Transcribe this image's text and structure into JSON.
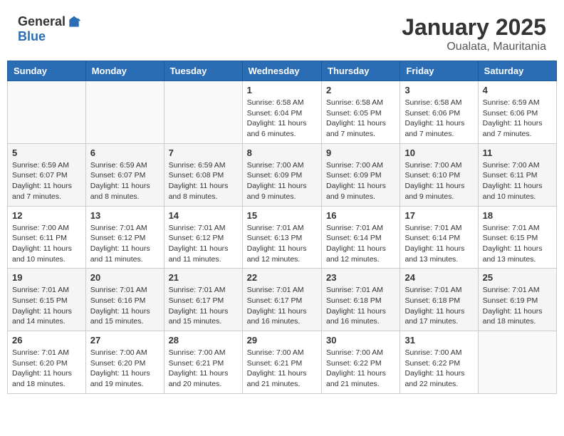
{
  "header": {
    "logo_general": "General",
    "logo_blue": "Blue",
    "month": "January 2025",
    "location": "Oualata, Mauritania"
  },
  "days_of_week": [
    "Sunday",
    "Monday",
    "Tuesday",
    "Wednesday",
    "Thursday",
    "Friday",
    "Saturday"
  ],
  "weeks": [
    [
      {
        "day": "",
        "info": ""
      },
      {
        "day": "",
        "info": ""
      },
      {
        "day": "",
        "info": ""
      },
      {
        "day": "1",
        "info": "Sunrise: 6:58 AM\nSunset: 6:04 PM\nDaylight: 11 hours and 6 minutes."
      },
      {
        "day": "2",
        "info": "Sunrise: 6:58 AM\nSunset: 6:05 PM\nDaylight: 11 hours and 7 minutes."
      },
      {
        "day": "3",
        "info": "Sunrise: 6:58 AM\nSunset: 6:06 PM\nDaylight: 11 hours and 7 minutes."
      },
      {
        "day": "4",
        "info": "Sunrise: 6:59 AM\nSunset: 6:06 PM\nDaylight: 11 hours and 7 minutes."
      }
    ],
    [
      {
        "day": "5",
        "info": "Sunrise: 6:59 AM\nSunset: 6:07 PM\nDaylight: 11 hours and 7 minutes."
      },
      {
        "day": "6",
        "info": "Sunrise: 6:59 AM\nSunset: 6:07 PM\nDaylight: 11 hours and 8 minutes."
      },
      {
        "day": "7",
        "info": "Sunrise: 6:59 AM\nSunset: 6:08 PM\nDaylight: 11 hours and 8 minutes."
      },
      {
        "day": "8",
        "info": "Sunrise: 7:00 AM\nSunset: 6:09 PM\nDaylight: 11 hours and 9 minutes."
      },
      {
        "day": "9",
        "info": "Sunrise: 7:00 AM\nSunset: 6:09 PM\nDaylight: 11 hours and 9 minutes."
      },
      {
        "day": "10",
        "info": "Sunrise: 7:00 AM\nSunset: 6:10 PM\nDaylight: 11 hours and 9 minutes."
      },
      {
        "day": "11",
        "info": "Sunrise: 7:00 AM\nSunset: 6:11 PM\nDaylight: 11 hours and 10 minutes."
      }
    ],
    [
      {
        "day": "12",
        "info": "Sunrise: 7:00 AM\nSunset: 6:11 PM\nDaylight: 11 hours and 10 minutes."
      },
      {
        "day": "13",
        "info": "Sunrise: 7:01 AM\nSunset: 6:12 PM\nDaylight: 11 hours and 11 minutes."
      },
      {
        "day": "14",
        "info": "Sunrise: 7:01 AM\nSunset: 6:12 PM\nDaylight: 11 hours and 11 minutes."
      },
      {
        "day": "15",
        "info": "Sunrise: 7:01 AM\nSunset: 6:13 PM\nDaylight: 11 hours and 12 minutes."
      },
      {
        "day": "16",
        "info": "Sunrise: 7:01 AM\nSunset: 6:14 PM\nDaylight: 11 hours and 12 minutes."
      },
      {
        "day": "17",
        "info": "Sunrise: 7:01 AM\nSunset: 6:14 PM\nDaylight: 11 hours and 13 minutes."
      },
      {
        "day": "18",
        "info": "Sunrise: 7:01 AM\nSunset: 6:15 PM\nDaylight: 11 hours and 13 minutes."
      }
    ],
    [
      {
        "day": "19",
        "info": "Sunrise: 7:01 AM\nSunset: 6:15 PM\nDaylight: 11 hours and 14 minutes."
      },
      {
        "day": "20",
        "info": "Sunrise: 7:01 AM\nSunset: 6:16 PM\nDaylight: 11 hours and 15 minutes."
      },
      {
        "day": "21",
        "info": "Sunrise: 7:01 AM\nSunset: 6:17 PM\nDaylight: 11 hours and 15 minutes."
      },
      {
        "day": "22",
        "info": "Sunrise: 7:01 AM\nSunset: 6:17 PM\nDaylight: 11 hours and 16 minutes."
      },
      {
        "day": "23",
        "info": "Sunrise: 7:01 AM\nSunset: 6:18 PM\nDaylight: 11 hours and 16 minutes."
      },
      {
        "day": "24",
        "info": "Sunrise: 7:01 AM\nSunset: 6:18 PM\nDaylight: 11 hours and 17 minutes."
      },
      {
        "day": "25",
        "info": "Sunrise: 7:01 AM\nSunset: 6:19 PM\nDaylight: 11 hours and 18 minutes."
      }
    ],
    [
      {
        "day": "26",
        "info": "Sunrise: 7:01 AM\nSunset: 6:20 PM\nDaylight: 11 hours and 18 minutes."
      },
      {
        "day": "27",
        "info": "Sunrise: 7:00 AM\nSunset: 6:20 PM\nDaylight: 11 hours and 19 minutes."
      },
      {
        "day": "28",
        "info": "Sunrise: 7:00 AM\nSunset: 6:21 PM\nDaylight: 11 hours and 20 minutes."
      },
      {
        "day": "29",
        "info": "Sunrise: 7:00 AM\nSunset: 6:21 PM\nDaylight: 11 hours and 21 minutes."
      },
      {
        "day": "30",
        "info": "Sunrise: 7:00 AM\nSunset: 6:22 PM\nDaylight: 11 hours and 21 minutes."
      },
      {
        "day": "31",
        "info": "Sunrise: 7:00 AM\nSunset: 6:22 PM\nDaylight: 11 hours and 22 minutes."
      },
      {
        "day": "",
        "info": ""
      }
    ]
  ]
}
